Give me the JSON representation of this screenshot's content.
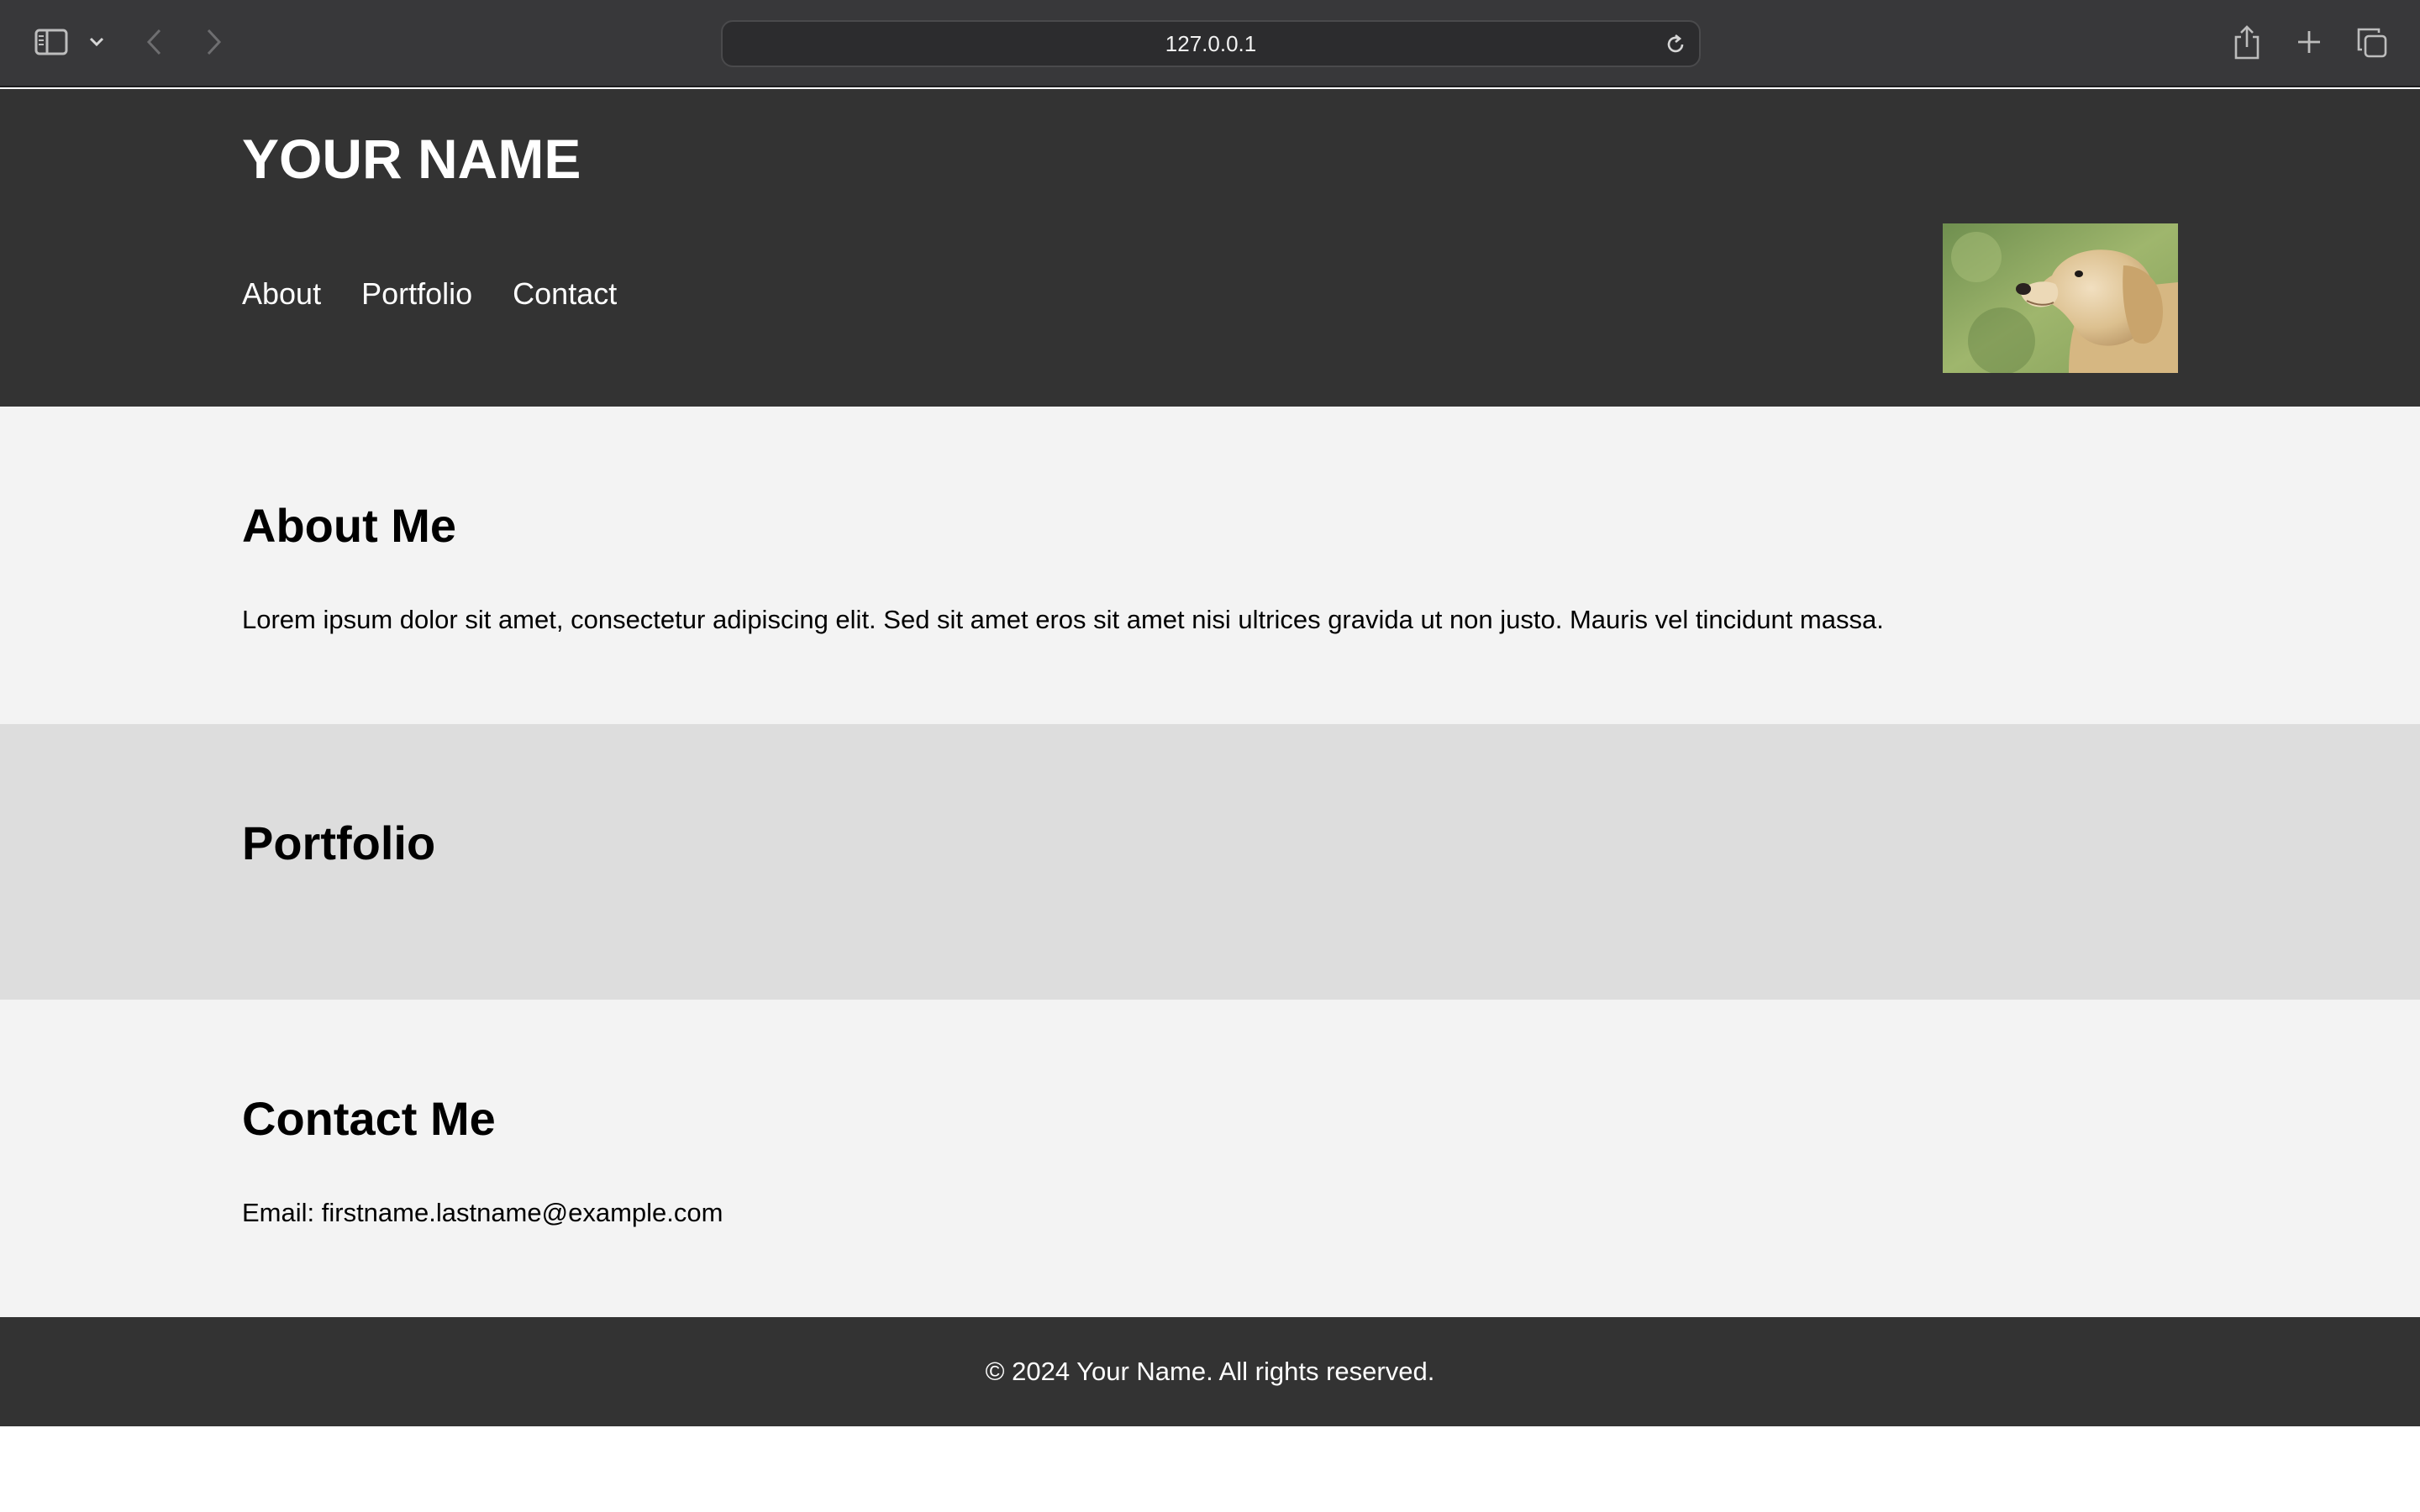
{
  "browser": {
    "url": "127.0.0.1",
    "icons": {
      "sidebar": "sidebar-icon",
      "chevron": "chevron-down-icon",
      "back": "back-arrow-icon",
      "forward": "forward-arrow-icon",
      "reload": "reload-icon",
      "share": "share-icon",
      "new_tab": "plus-icon",
      "tabs": "tab-overview-icon"
    }
  },
  "header": {
    "title": "YOUR NAME",
    "nav": [
      "About",
      "Portfolio",
      "Contact"
    ],
    "photo_alt": "golden retriever puppy photo"
  },
  "about": {
    "heading": "About Me",
    "text": "Lorem ipsum dolor sit amet, consectetur adipiscing elit. Sed sit amet eros sit amet nisi ultrices gravida ut non justo. Mauris vel tincidunt massa."
  },
  "portfolio": {
    "heading": "Portfolio"
  },
  "contact": {
    "heading": "Contact Me",
    "email_line": "Email: firstname.lastname@example.com"
  },
  "footer": {
    "text": "© 2024 Your Name. All rights reserved."
  },
  "colors": {
    "chrome_bg": "#38383a",
    "header_bg": "#333333",
    "section_light": "#f3f3f3",
    "section_gray": "#dddddd",
    "footer_bg": "#333333"
  }
}
